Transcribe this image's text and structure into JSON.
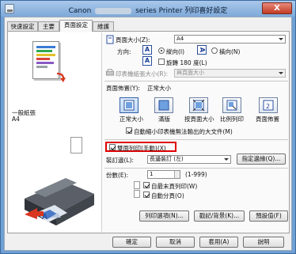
{
  "window": {
    "title_prefix": "Canon",
    "title_suffix": "series Printer 列印喜好設定",
    "close_label": "X"
  },
  "tabs": [
    "快速設定",
    "主要",
    "頁面設定",
    "維護"
  ],
  "active_tab": 2,
  "preview": {
    "media_label": "一般紙張",
    "size_label": "A4"
  },
  "page_size": {
    "label": "頁面大小(Z):",
    "value": "A4",
    "orientation_label": "方向:",
    "portrait": "縱向(I)",
    "landscape": "橫向(N)",
    "rotate": "旋轉 180 度(L)",
    "printer_paper_label": "印表機紙張大小(R):",
    "printer_paper_value": "與頁面大小"
  },
  "layout": {
    "label": "頁面佈置(Y):",
    "current": "正常大小",
    "options": [
      "正常大小",
      "滿版",
      "按頁面大小",
      "比例列印",
      "頁面佈置"
    ],
    "selected": 0,
    "auto_reduce": "自動縮小印表機無法輸出的大文件(M)"
  },
  "duplex": {
    "label": "雙面列印(手動)(X)",
    "checked": true,
    "binding_label": "裝訂邊(L):",
    "binding_value": "長邊裝訂 (左)",
    "margin_button": "指定邊緣(Q)..."
  },
  "copies": {
    "label": "份數(E):",
    "value": "1",
    "range": "(1-999)",
    "last_page_first": "自最末頁列印(W)",
    "collate": "自動分頁(O)"
  },
  "options_buttons": [
    "列印選項(N)...",
    "戳記/背景(K)...",
    "預設值(F)"
  ],
  "footer_buttons": [
    "確定",
    "取消",
    "套用(A)",
    "說明"
  ],
  "colors": {
    "highlight": "#e00000",
    "title_bg": "#7ea9d9",
    "accent": "#1c3f95"
  }
}
